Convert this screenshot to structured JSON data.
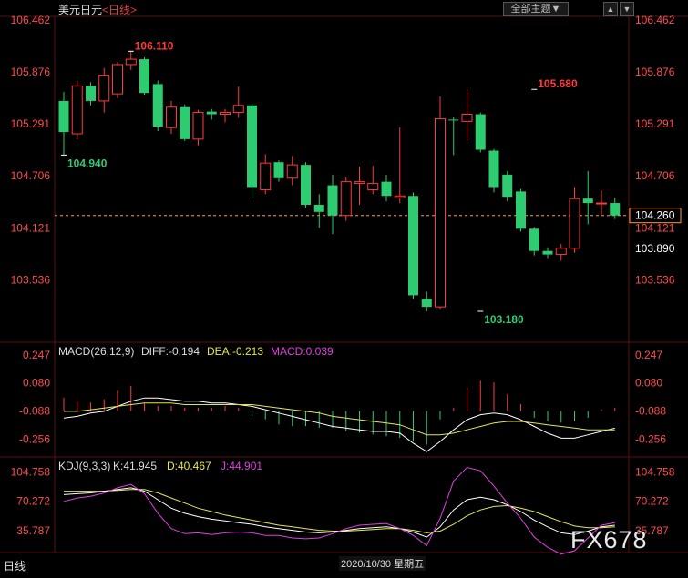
{
  "header": {
    "title": "美元日元",
    "subtitle": "<日线>",
    "theme_label": "全部主题▼",
    "nav_up": "▲",
    "nav_down": "▼"
  },
  "footer": {
    "period": "日线",
    "date": "2020/10/30 星期五",
    "watermark": "FX678"
  },
  "colors": {
    "up": "#ff3b3b",
    "down": "#2ecc71",
    "dif_line": "#ffffff",
    "dea_line": "#e6e64a",
    "macd_text": "#e040e0",
    "k_line": "#ffffff",
    "d_line": "#e6e64a",
    "j_line": "#e040e0",
    "grid": "#5a1010",
    "price_axis": "#ff4d4d"
  },
  "chart_data": [
    {
      "type": "candlestick",
      "title": "美元日元 <日线>",
      "ylim": [
        103.18,
        106.462
      ],
      "yticks": [
        "106.462",
        "105.876",
        "105.291",
        "104.706",
        "104.121",
        "103.536"
      ],
      "current_price": 104.26,
      "current_price_label": "104.260",
      "level_label": "103.890",
      "annotations": [
        {
          "text": "106.110",
          "index": 5,
          "value": 106.11,
          "type": "high"
        },
        {
          "text": "104.940",
          "index": 0,
          "value": 104.94,
          "type": "low"
        },
        {
          "text": "105.680",
          "index": 35,
          "value": 105.68,
          "type": "high"
        },
        {
          "text": "103.180",
          "index": 31,
          "value": 103.18,
          "type": "low"
        }
      ],
      "candles": [
        {
          "o": 105.55,
          "h": 105.65,
          "l": 104.94,
          "c": 105.2
        },
        {
          "o": 105.18,
          "h": 105.78,
          "l": 105.12,
          "c": 105.72
        },
        {
          "o": 105.72,
          "h": 105.76,
          "l": 105.5,
          "c": 105.55
        },
        {
          "o": 105.55,
          "h": 105.92,
          "l": 105.42,
          "c": 105.84
        },
        {
          "o": 105.63,
          "h": 105.99,
          "l": 105.58,
          "c": 105.96
        },
        {
          "o": 105.96,
          "h": 106.11,
          "l": 105.9,
          "c": 106.02
        },
        {
          "o": 106.02,
          "h": 106.04,
          "l": 105.62,
          "c": 105.64
        },
        {
          "o": 105.74,
          "h": 105.78,
          "l": 105.21,
          "c": 105.26
        },
        {
          "o": 105.25,
          "h": 105.55,
          "l": 105.18,
          "c": 105.48
        },
        {
          "o": 105.48,
          "h": 105.51,
          "l": 105.1,
          "c": 105.12
        },
        {
          "o": 105.12,
          "h": 105.45,
          "l": 105.05,
          "c": 105.42
        },
        {
          "o": 105.43,
          "h": 105.46,
          "l": 105.34,
          "c": 105.4
        },
        {
          "o": 105.4,
          "h": 105.46,
          "l": 105.31,
          "c": 105.42
        },
        {
          "o": 105.42,
          "h": 105.71,
          "l": 105.36,
          "c": 105.5
        },
        {
          "o": 105.5,
          "h": 105.52,
          "l": 104.45,
          "c": 104.58
        },
        {
          "o": 104.55,
          "h": 104.95,
          "l": 104.5,
          "c": 104.85
        },
        {
          "o": 104.86,
          "h": 104.88,
          "l": 104.64,
          "c": 104.68
        },
        {
          "o": 104.68,
          "h": 104.93,
          "l": 104.6,
          "c": 104.83
        },
        {
          "o": 104.83,
          "h": 104.86,
          "l": 104.35,
          "c": 104.38
        },
        {
          "o": 104.38,
          "h": 104.5,
          "l": 104.12,
          "c": 104.3
        },
        {
          "o": 104.6,
          "h": 104.72,
          "l": 104.05,
          "c": 104.26
        },
        {
          "o": 104.26,
          "h": 104.69,
          "l": 104.2,
          "c": 104.64
        },
        {
          "o": 104.62,
          "h": 104.81,
          "l": 104.38,
          "c": 104.64
        },
        {
          "o": 104.55,
          "h": 104.82,
          "l": 104.5,
          "c": 104.62
        },
        {
          "o": 104.64,
          "h": 104.72,
          "l": 104.42,
          "c": 104.48
        },
        {
          "o": 104.46,
          "h": 105.25,
          "l": 104.4,
          "c": 104.48
        },
        {
          "o": 104.48,
          "h": 104.52,
          "l": 103.32,
          "c": 103.36
        },
        {
          "o": 103.32,
          "h": 103.4,
          "l": 103.18,
          "c": 103.23
        },
        {
          "o": 103.23,
          "h": 105.6,
          "l": 103.2,
          "c": 105.35
        },
        {
          "o": 105.34,
          "h": 105.37,
          "l": 104.94,
          "c": 105.33
        },
        {
          "o": 105.32,
          "h": 105.68,
          "l": 105.1,
          "c": 105.4
        },
        {
          "o": 105.4,
          "h": 105.42,
          "l": 104.97,
          "c": 105.0
        },
        {
          "o": 104.99,
          "h": 105.01,
          "l": 104.52,
          "c": 104.58
        },
        {
          "o": 104.72,
          "h": 104.76,
          "l": 104.42,
          "c": 104.47
        },
        {
          "o": 104.53,
          "h": 104.56,
          "l": 104.08,
          "c": 104.11
        },
        {
          "o": 104.11,
          "h": 104.13,
          "l": 103.81,
          "c": 103.86
        },
        {
          "o": 103.86,
          "h": 103.9,
          "l": 103.78,
          "c": 103.82
        },
        {
          "o": 103.82,
          "h": 103.94,
          "l": 103.75,
          "c": 103.89
        },
        {
          "o": 103.89,
          "h": 104.58,
          "l": 103.84,
          "c": 104.45
        },
        {
          "o": 104.45,
          "h": 104.76,
          "l": 104.16,
          "c": 104.4
        },
        {
          "o": 104.39,
          "h": 104.54,
          "l": 104.27,
          "c": 104.4
        },
        {
          "o": 104.4,
          "h": 104.46,
          "l": 104.22,
          "c": 104.26
        }
      ]
    },
    {
      "type": "macd",
      "label": "MACD(26,12,9)",
      "dif_label": "DIFF:-0.194",
      "dea_label": "DEA:-0.213",
      "macd_label": "MACD:0.039",
      "ylim": [
        -0.34,
        0.3
      ],
      "yticks": [
        "0.247",
        "0.080",
        "-0.088",
        "-0.256"
      ],
      "dif": [
        -0.13,
        -0.12,
        -0.1,
        -0.09,
        -0.06,
        -0.03,
        -0.01,
        -0.01,
        -0.02,
        -0.03,
        -0.03,
        -0.04,
        -0.04,
        -0.05,
        -0.06,
        -0.08,
        -0.1,
        -0.12,
        -0.14,
        -0.16,
        -0.18,
        -0.19,
        -0.2,
        -0.21,
        -0.21,
        -0.22,
        -0.28,
        -0.33,
        -0.27,
        -0.2,
        -0.14,
        -0.11,
        -0.1,
        -0.11,
        -0.14,
        -0.18,
        -0.22,
        -0.25,
        -0.25,
        -0.23,
        -0.21,
        -0.19
      ],
      "dea": [
        -0.09,
        -0.09,
        -0.08,
        -0.07,
        -0.06,
        -0.05,
        -0.04,
        -0.04,
        -0.04,
        -0.05,
        -0.05,
        -0.05,
        -0.05,
        -0.05,
        -0.05,
        -0.06,
        -0.07,
        -0.08,
        -0.09,
        -0.1,
        -0.12,
        -0.13,
        -0.14,
        -0.15,
        -0.16,
        -0.17,
        -0.2,
        -0.23,
        -0.23,
        -0.22,
        -0.2,
        -0.18,
        -0.16,
        -0.15,
        -0.15,
        -0.16,
        -0.17,
        -0.18,
        -0.19,
        -0.2,
        -0.2,
        -0.2
      ],
      "hist": [
        0.08,
        0.06,
        0.05,
        0.07,
        0.12,
        0.15,
        0.05,
        0.03,
        0.03,
        0.02,
        0.02,
        0.02,
        0.03,
        0.02,
        -0.03,
        -0.05,
        -0.08,
        -0.09,
        -0.09,
        -0.1,
        -0.1,
        -0.12,
        -0.13,
        -0.14,
        -0.15,
        -0.16,
        -0.18,
        -0.2,
        -0.05,
        0.02,
        0.14,
        0.18,
        0.17,
        0.1,
        0.04,
        -0.04,
        -0.06,
        -0.07,
        -0.06,
        -0.04,
        0.01,
        0.02
      ]
    },
    {
      "type": "kdj",
      "label": "KDJ(9,3,3)",
      "k_label": "K:41.945",
      "d_label": "D:40.467",
      "j_label": "J:44.901",
      "ylim": [
        12,
        118
      ],
      "yticks": [
        "104.758",
        "70.272",
        "35.787"
      ],
      "k": [
        78,
        79,
        80,
        82,
        84,
        86,
        82,
        72,
        62,
        56,
        52,
        49,
        47,
        45,
        43,
        40,
        38,
        36,
        34,
        33,
        34,
        36,
        38,
        39,
        40,
        38,
        34,
        28,
        40,
        60,
        72,
        75,
        72,
        66,
        58,
        48,
        40,
        33,
        31,
        35,
        40,
        42
      ],
      "d": [
        82,
        82,
        82,
        82,
        83,
        84,
        84,
        80,
        74,
        68,
        62,
        58,
        54,
        51,
        48,
        45,
        42,
        40,
        38,
        36,
        35,
        35,
        36,
        37,
        38,
        38,
        36,
        33,
        35,
        43,
        53,
        60,
        64,
        65,
        62,
        58,
        52,
        46,
        41,
        39,
        39,
        40
      ],
      "j": [
        70,
        74,
        76,
        80,
        86,
        90,
        79,
        56,
        38,
        32,
        33,
        31,
        33,
        34,
        33,
        30,
        30,
        27,
        26,
        27,
        32,
        38,
        42,
        43,
        44,
        38,
        30,
        18,
        50,
        94,
        110,
        106,
        88,
        68,
        50,
        28,
        16,
        8,
        12,
        27,
        42,
        45
      ]
    }
  ]
}
